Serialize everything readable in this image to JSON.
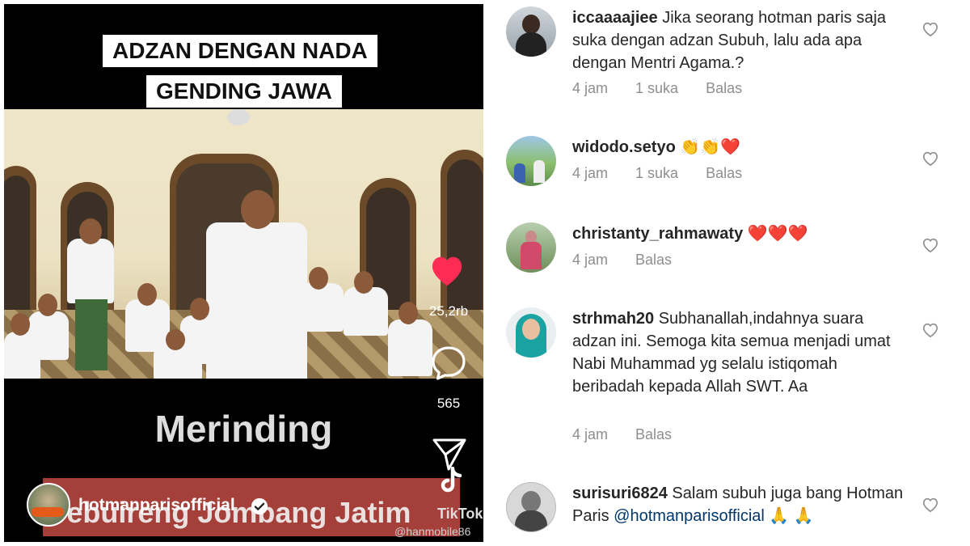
{
  "video": {
    "caption_line1": "ADZAN DENGAN NADA",
    "caption_line2": "GENDING JAWA",
    "overlay_text": "Merinding",
    "banner_text": "Tebuireng Jombang Jatim",
    "username": "hotmanparisofficial",
    "likes": "25,2rb",
    "comments": "565",
    "tiktok_label": "TikTok",
    "watermark": "@hanmobile86"
  },
  "comments": [
    {
      "user": "iccaaaajiee",
      "text": "Jika seorang hotman paris saja suka dengan adzan Subuh, lalu ada apa dengan Mentri Agama.?",
      "time": "4 jam",
      "likes": "1 suka",
      "reply": "Balas"
    },
    {
      "user": "widodo.setyo",
      "text": "👏👏❤️",
      "time": "4 jam",
      "likes": "1 suka",
      "reply": "Balas"
    },
    {
      "user": "christanty_rahmawaty",
      "text": "❤️❤️❤️",
      "time": "4 jam",
      "reply": "Balas"
    },
    {
      "user": "strhmah20",
      "text": "Subhanallah,indahnya suara adzan ini. Semoga kita semua menjadi umat Nabi Muhammad yg selalu istiqomah beribadah kepada Allah SWT. Aa",
      "time": "4 jam",
      "reply": "Balas"
    },
    {
      "user": "surisuri6824",
      "text": "Salam subuh juga bang Hotman Paris",
      "mention": "@hotmanparisofficial",
      "text_end": "🙏 🙏"
    }
  ],
  "colors": {
    "like_red": "#fe2c55",
    "meta_gray": "#8e8e8e",
    "mention_blue": "#00376b"
  }
}
